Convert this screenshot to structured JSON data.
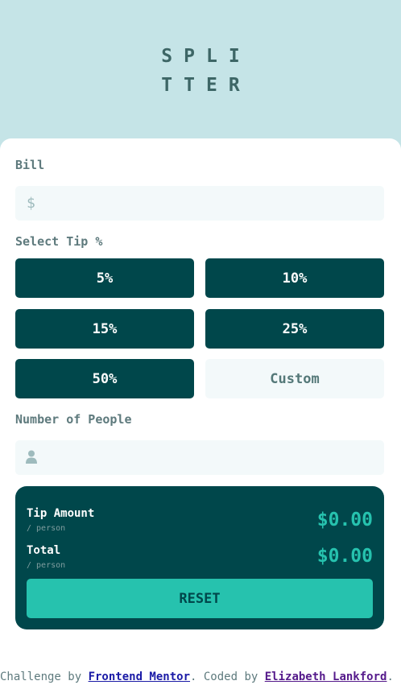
{
  "logo": {
    "line1": "SPLI",
    "line2": "TTER"
  },
  "bill": {
    "label": "Bill",
    "prefix": "$",
    "value": ""
  },
  "tip": {
    "label": "Select Tip %",
    "options": [
      "5%",
      "10%",
      "15%",
      "25%",
      "50%"
    ],
    "custom_placeholder": "Custom"
  },
  "people": {
    "label": "Number of People",
    "value": ""
  },
  "result": {
    "tip_amount_label": "Tip Amount",
    "tip_amount_sub": "/ person",
    "tip_amount_value": "$0.00",
    "total_label": "Total",
    "total_sub": "/ person",
    "total_value": "$0.00",
    "reset_label": "RESET"
  },
  "footer": {
    "prefix": "Challenge by ",
    "link1": "Frontend Mentor",
    "middle": ". Coded by ",
    "link2": "Elizabeth Lankford",
    "suffix": "."
  },
  "colors": {
    "background": "#c5e4e7",
    "dark_cyan": "#00474b",
    "strong_cyan": "#26c2ae",
    "light_field": "#f3f9fa"
  }
}
